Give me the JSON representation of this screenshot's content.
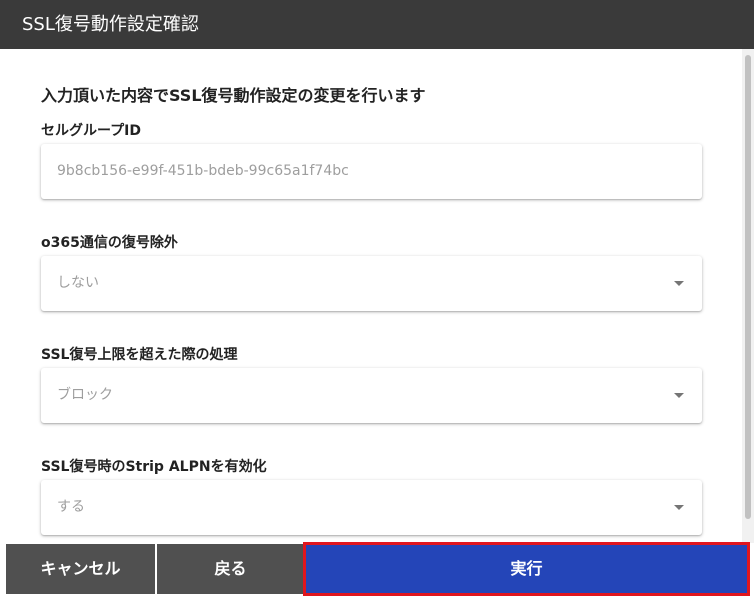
{
  "dialog": {
    "title": "SSL復号動作設定確認",
    "intro": "入力頂いた内容でSSL復号動作設定の変更を行います"
  },
  "fields": [
    {
      "label": "セルグループID",
      "value": "9b8cb156-e99f-451b-bdeb-99c65a1f74bc",
      "type": "text"
    },
    {
      "label": "o365通信の復号除外",
      "value": "しない",
      "type": "select"
    },
    {
      "label": "SSL復号上限を超えた際の処理",
      "value": "ブロック",
      "type": "select"
    },
    {
      "label": "SSL復号時のStrip ALPNを有効化",
      "value": "する",
      "type": "select"
    }
  ],
  "footer": {
    "cancel_label": "キャンセル",
    "back_label": "戻る",
    "run_label": "実行"
  },
  "colors": {
    "titlebar": "#3a3a3a",
    "secondary_button": "#505050",
    "primary_button": "#2445b8",
    "highlight_border": "#e0161e"
  }
}
